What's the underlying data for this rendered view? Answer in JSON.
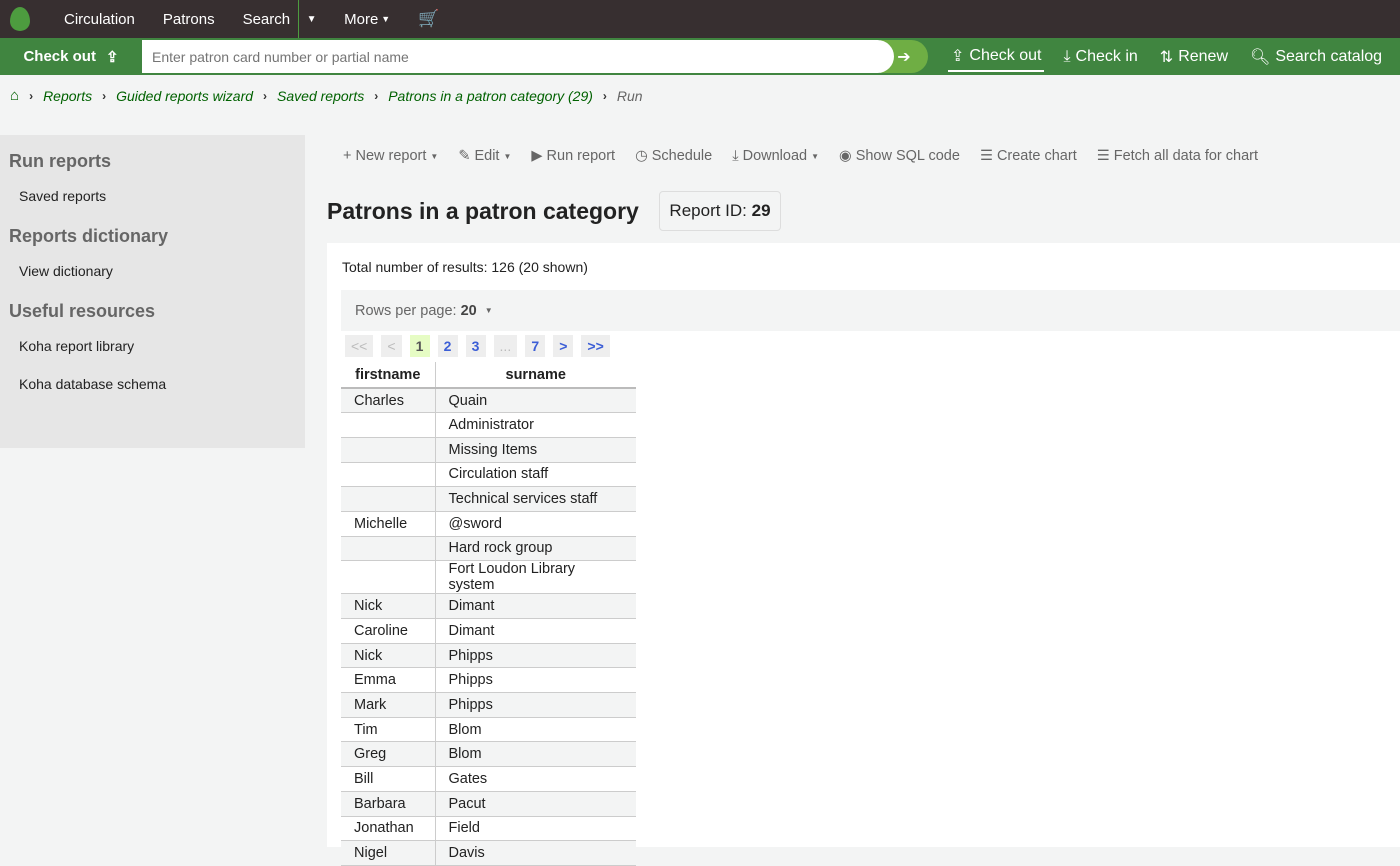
{
  "topnav": {
    "items": [
      "Circulation",
      "Patrons",
      "Search",
      "More"
    ]
  },
  "checkout_bar": {
    "label": "Check out",
    "placeholder": "Enter patron card number or partial name",
    "quick": [
      "Check out",
      "Check in",
      "Renew",
      "Search catalog"
    ]
  },
  "breadcrumb": [
    "Reports",
    "Guided reports wizard",
    "Saved reports",
    "Patrons in a patron category (29)",
    "Run"
  ],
  "sidebar": {
    "sections": [
      {
        "title": "Run reports",
        "links": [
          "Saved reports"
        ]
      },
      {
        "title": "Reports dictionary",
        "links": [
          "View dictionary"
        ]
      },
      {
        "title": "Useful resources",
        "links": [
          "Koha report library",
          "Koha database schema"
        ]
      }
    ]
  },
  "toolbar": [
    "New report",
    "Edit",
    "Run report",
    "Schedule",
    "Download",
    "Show SQL code",
    "Create chart",
    "Fetch all data for chart"
  ],
  "report": {
    "title": "Patrons in a patron category",
    "id_label": "Report ID:",
    "id": "29",
    "total": "Total number of results: 126 (20 shown)",
    "rows_label": "Rows per page:",
    "rows_value": "20"
  },
  "pager": [
    "<<",
    "<",
    "1",
    "2",
    "3",
    "...",
    "7",
    ">",
    ">>"
  ],
  "table": {
    "headers": [
      "firstname",
      "surname"
    ],
    "rows": [
      [
        "Charles",
        "Quain"
      ],
      [
        "",
        "Administrator"
      ],
      [
        "",
        "Missing Items"
      ],
      [
        "",
        "Circulation staff"
      ],
      [
        "",
        "Technical services staff"
      ],
      [
        "Michelle",
        "@sword"
      ],
      [
        "",
        "Hard rock group"
      ],
      [
        "",
        "Fort Loudon Library system"
      ],
      [
        "Nick",
        "Dimant"
      ],
      [
        "Caroline",
        "Dimant"
      ],
      [
        "Nick",
        "Phipps"
      ],
      [
        "Emma",
        "Phipps"
      ],
      [
        "Mark",
        "Phipps"
      ],
      [
        "Tim",
        "Blom"
      ],
      [
        "Greg",
        "Blom"
      ],
      [
        "Bill",
        "Gates"
      ],
      [
        "Barbara",
        "Pacut"
      ],
      [
        "Jonathan",
        "Field"
      ],
      [
        "Nigel",
        "Davis"
      ]
    ]
  }
}
